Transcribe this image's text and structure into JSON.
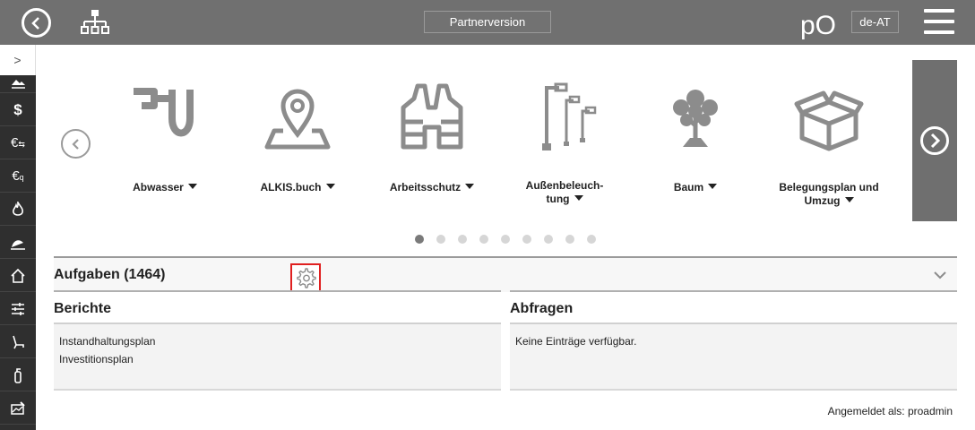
{
  "topbar": {
    "partner_label": "Partnerversion",
    "language": "de-AT",
    "logo_text": "pO"
  },
  "sidebar": {
    "toggle": ">",
    "items": [
      {
        "icon": "landscape-icon"
      },
      {
        "icon": "dollar-icon"
      },
      {
        "icon": "euro-transfer-icon"
      },
      {
        "icon": "euro-search-icon"
      },
      {
        "icon": "flame-icon"
      },
      {
        "icon": "satellite-dish-icon"
      },
      {
        "icon": "house-icon"
      },
      {
        "icon": "filter-lines-icon"
      },
      {
        "icon": "chair-icon"
      },
      {
        "icon": "fire-extinguisher-icon"
      },
      {
        "icon": "map-edit-icon"
      }
    ]
  },
  "carousel": {
    "tiles": [
      {
        "label": "Abwasser",
        "icon": "pipe-icon"
      },
      {
        "label": "ALKIS.buch",
        "icon": "map-pin-icon"
      },
      {
        "label": "Arbeitsschutz",
        "icon": "safety-vest-icon"
      },
      {
        "label_line1": "Außenbeleuch-",
        "label_line2": "tung",
        "icon": "street-lamp-icon"
      },
      {
        "label": "Baum",
        "icon": "tree-icon"
      },
      {
        "label_line1": "Belegungsplan und",
        "label_line2": "Umzug",
        "icon": "box-icon"
      }
    ],
    "page_count": 9,
    "active_page": 1
  },
  "aufgaben": {
    "title": "Aufgaben (1464)"
  },
  "berichte": {
    "title": "Berichte",
    "items": [
      "Instandhaltungsplan",
      "Investitionsplan"
    ]
  },
  "abfragen": {
    "title": "Abfragen",
    "empty_text": "Keine Einträge verfügbar."
  },
  "footer": {
    "logged_in": "Angemeldet als: proadmin"
  }
}
